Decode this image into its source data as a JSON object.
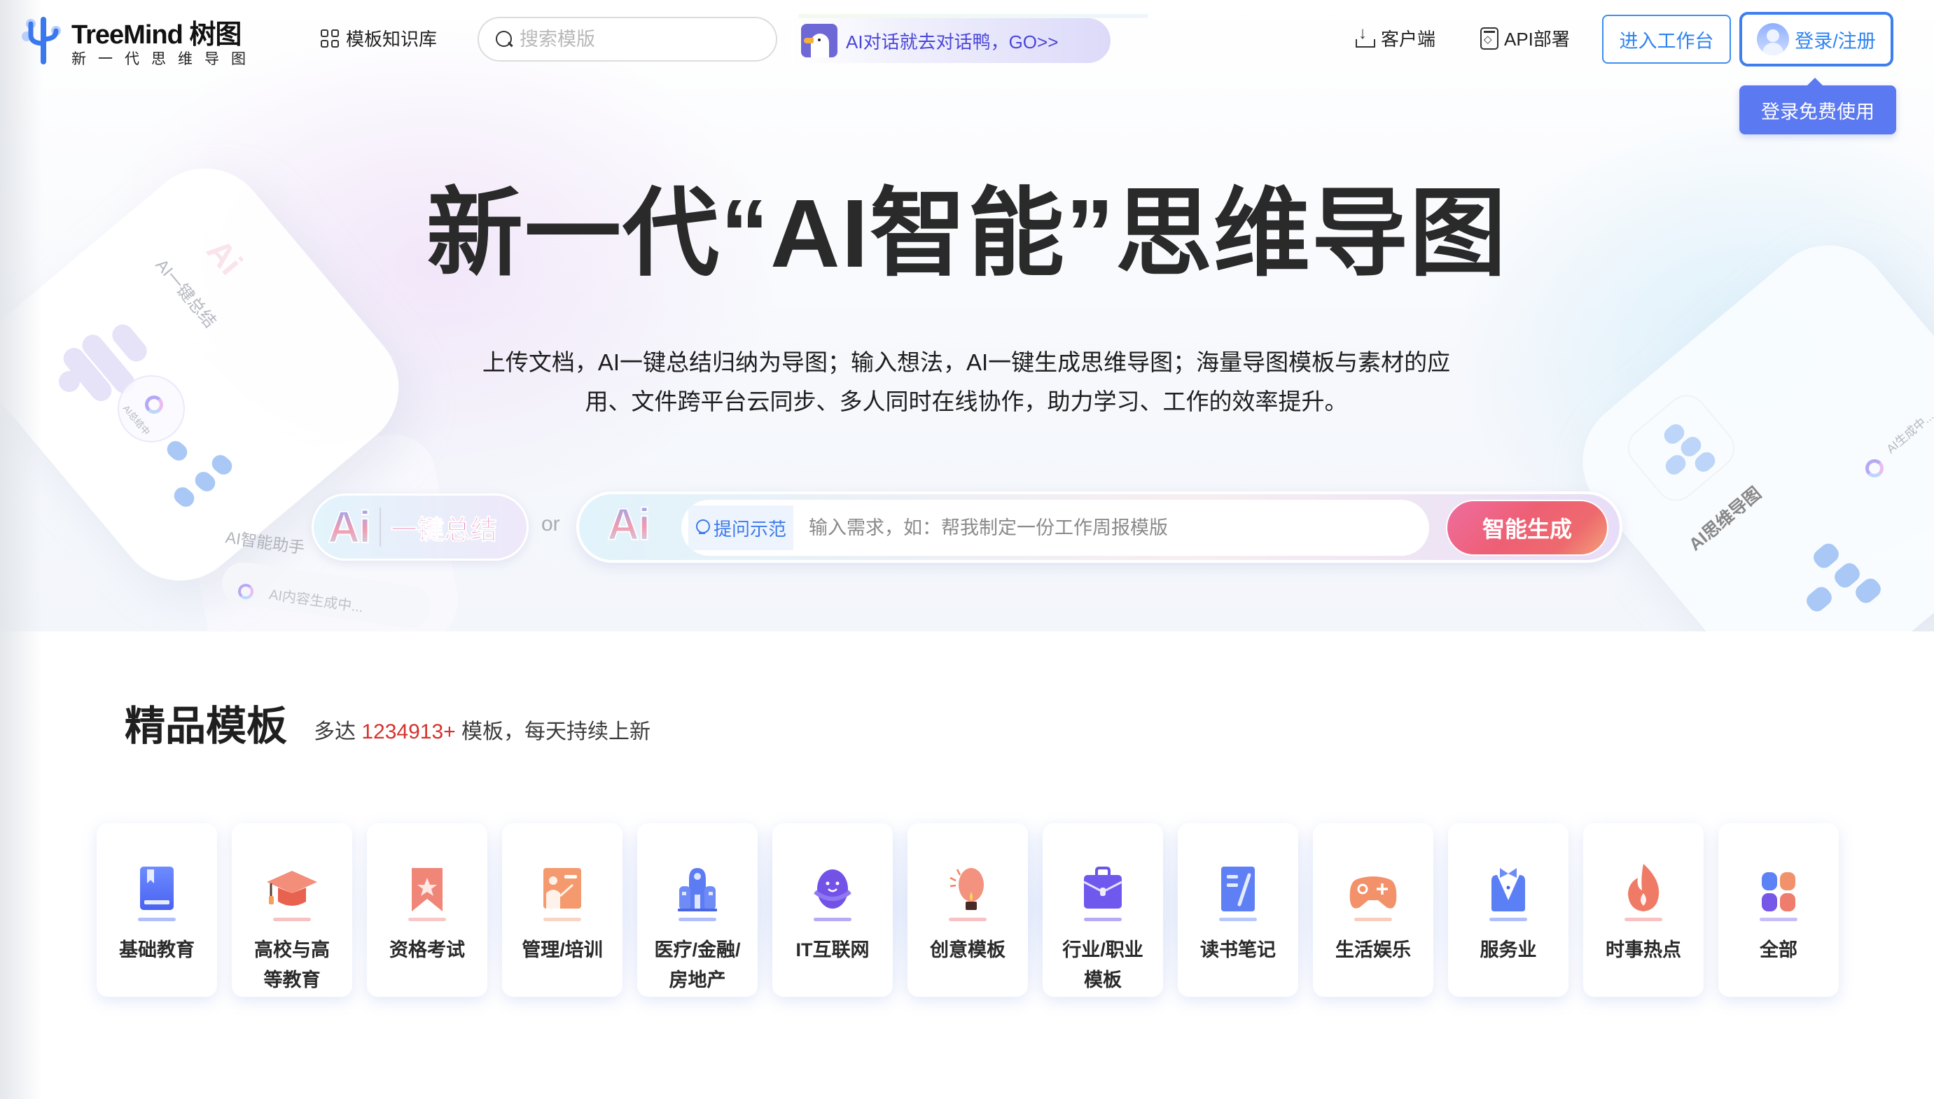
{
  "header": {
    "logo": {
      "name": "TreeMind 树图",
      "tagline": "新一代思维导图"
    },
    "nav_knowledge": "模板知识库",
    "search": {
      "placeholder": "搜索模版",
      "value": ""
    },
    "ai_banner": "AI对话就去对话鸭，GO>>",
    "client": "客户端",
    "api": "API部署",
    "workspace_button": "进入工作台",
    "login_button": "登录/注册",
    "tooltip": "登录免费使用"
  },
  "hero": {
    "title": "新一代“AI智能”思维导图",
    "description_line1": "上传文档，AI一键总结归纳为导图；输入想法，AI一键生成思维导图；海量导图模板与素材的应",
    "description_line2": "用、文件跨平台云同步、多人同时在线协作，助力学习、工作的效率提升。",
    "summary_pill": {
      "ai": "Ai",
      "label": "一键总结"
    },
    "or": "or",
    "generator": {
      "ai": "Ai",
      "hint": "提问示范",
      "placeholder": "输入需求，如：帮我制定一份工作周报模版",
      "value": "",
      "button": "智能生成"
    },
    "decorations": {
      "left_card": "AI一键总结",
      "left_spinner": "AI总结中",
      "assistant": "AI智能助手",
      "generating": "AI内容生成中...",
      "right_card": "AI思维导图",
      "right_generating": "AI生成中..."
    }
  },
  "templates": {
    "title": "精品模板",
    "subtitle_prefix": "多达",
    "count": "1234913+",
    "subtitle_suffix": "模板，每天持续上新",
    "categories": [
      {
        "label": "基础教育",
        "icon": "book-icon"
      },
      {
        "label": "高校与高等教育",
        "icon": "graduation-cap-icon"
      },
      {
        "label": "资格考试",
        "icon": "bookmark-star-icon"
      },
      {
        "label": "管理/培训",
        "icon": "teacher-board-icon"
      },
      {
        "label": "医疗/金融/房地产",
        "icon": "building-icon"
      },
      {
        "label": "IT互联网",
        "icon": "planet-icon"
      },
      {
        "label": "创意模板",
        "icon": "lightbulb-icon"
      },
      {
        "label": "行业/职业模板",
        "icon": "briefcase-icon"
      },
      {
        "label": "读书笔记",
        "icon": "note-pen-icon"
      },
      {
        "label": "生活娱乐",
        "icon": "gamepad-icon"
      },
      {
        "label": "服务业",
        "icon": "tuxedo-icon"
      },
      {
        "label": "时事热点",
        "icon": "flame-icon"
      },
      {
        "label": "全部",
        "icon": "grid-apps-icon"
      }
    ]
  }
}
